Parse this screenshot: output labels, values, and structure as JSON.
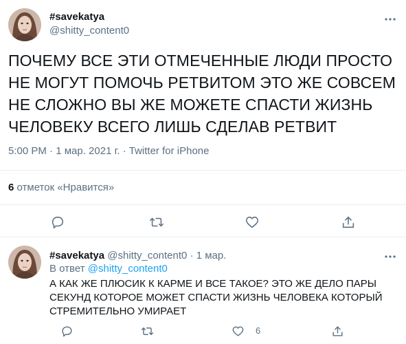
{
  "main_tweet": {
    "display_name": "#savekatya",
    "handle": "@shitty_content0",
    "text": "ПОЧЕМУ ВСЕ ЭТИ ОТМЕЧЕННЫЕ ЛЮДИ ПРОСТО НЕ МОГУТ ПОМОЧЬ РЕТВИТОМ ЭТО ЖЕ СОВСЕМ НЕ СЛОЖНО ВЫ ЖЕ МОЖЕТЕ СПАСТИ ЖИЗНЬ ЧЕЛОВЕКУ ВСЕГО ЛИШЬ СДЕЛАВ РЕТВИТ",
    "time": "5:00 PM",
    "separator": "·",
    "date": "1 мар. 2021 г.",
    "source": "Twitter for iPhone",
    "likes_count": "6",
    "likes_label": "отметок «Нравится»"
  },
  "reply_tweet": {
    "display_name": "#savekatya",
    "handle": "@shitty_content0",
    "separator": "·",
    "date": "1 мар.",
    "replying_prefix": "В ответ",
    "replying_to": "@shitty_content0",
    "text": "А КАК ЖЕ ПЛЮСИК К КАРМЕ И ВСЕ ТАКОЕ? ЭТО ЖЕ ДЕЛО ПАРЫ СЕКУНД КОТОРОЕ МОЖЕТ СПАСТИ ЖИЗНЬ ЧЕЛОВЕКА КОТОРЫЙ СТРЕМИТЕЛЬНО УМИРАЕТ",
    "like_count": "6"
  },
  "icons": {
    "more": "more-dots-icon",
    "reply": "reply-bubble-icon",
    "retweet": "retweet-icon",
    "like": "heart-icon",
    "share": "share-upload-icon"
  },
  "colors": {
    "text": "#0f1419",
    "secondary": "#5b7083",
    "link": "#1da1f2",
    "divider": "#ebeef0"
  }
}
